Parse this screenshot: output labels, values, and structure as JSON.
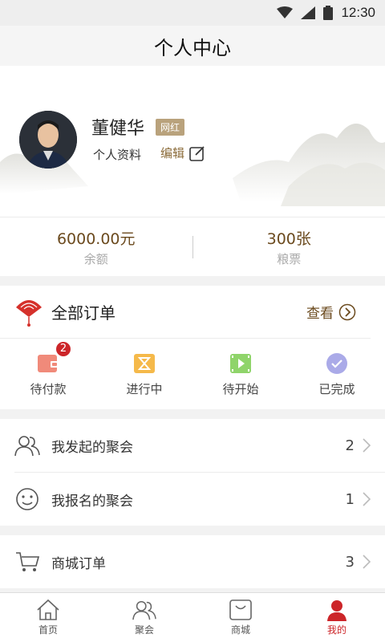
{
  "status_bar": {
    "time": "12:30"
  },
  "header": {
    "title": "个人中心"
  },
  "profile": {
    "name": "董健华",
    "badge": "网红",
    "info_label": "个人资料",
    "edit_label": "编辑"
  },
  "balance": {
    "amount": "6000.00元",
    "amount_label": "余额",
    "tickets": "300张",
    "tickets_label": "粮票"
  },
  "orders": {
    "title": "全部订单",
    "view_label": "查看",
    "statuses": [
      {
        "label": "待付款",
        "icon": "wallet-icon",
        "count": "2",
        "color": "#f08a7a"
      },
      {
        "label": "进行中",
        "icon": "hourglass-icon",
        "color": "#f5b94a"
      },
      {
        "label": "待开始",
        "icon": "video-icon",
        "color": "#8fd46a"
      },
      {
        "label": "已完成",
        "icon": "check-circle-icon",
        "color": "#aaaae8"
      }
    ]
  },
  "meetups": [
    {
      "label": "我发起的聚会",
      "count": "2",
      "icon": "users-icon"
    },
    {
      "label": "我报名的聚会",
      "count": "1",
      "icon": "smiley-icon"
    }
  ],
  "shop": {
    "label": "商城订单",
    "count": "3",
    "icon": "cart-icon"
  },
  "tabbar": {
    "items": [
      {
        "label": "首页",
        "icon": "home-icon"
      },
      {
        "label": "聚会",
        "icon": "users-icon"
      },
      {
        "label": "商城",
        "icon": "shop-icon"
      },
      {
        "label": "我的",
        "icon": "person-icon",
        "active": true
      }
    ],
    "active_color": "#cc2529"
  }
}
